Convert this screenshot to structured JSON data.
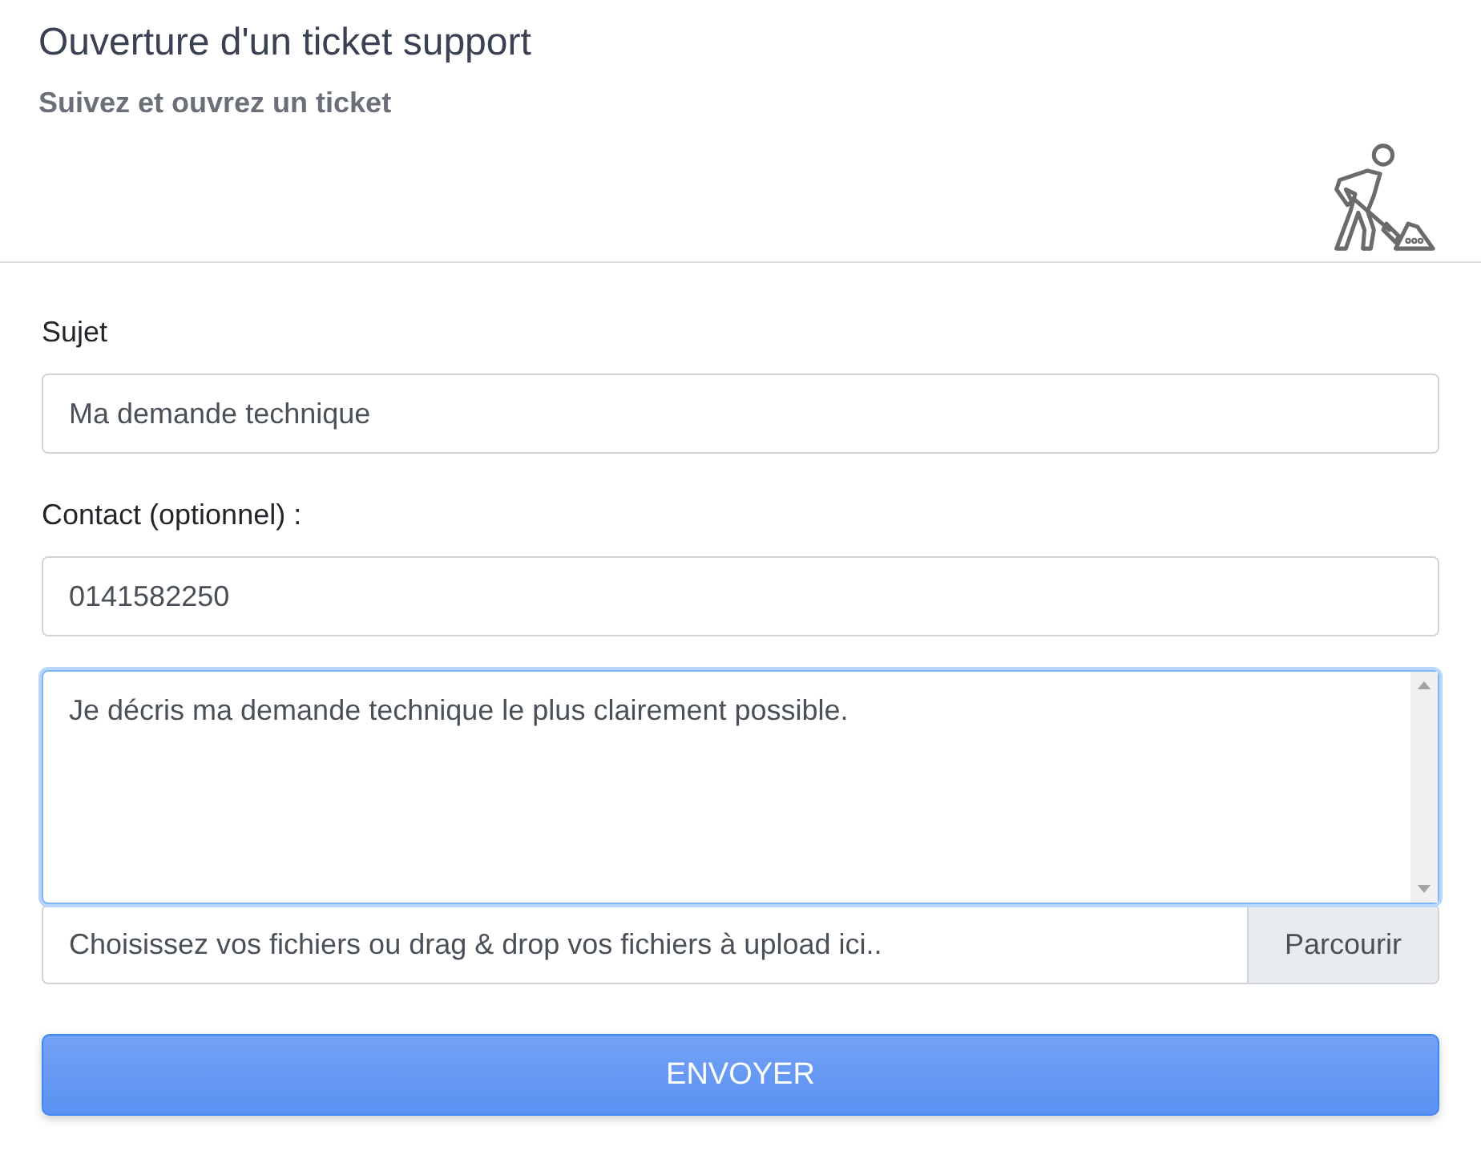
{
  "header": {
    "title": "Ouverture d'un ticket support",
    "subtitle": "Suivez et ouvrez un ticket"
  },
  "form": {
    "fields": [
      {
        "kind": "input",
        "label": "Sujet",
        "value": "Ma demande technique",
        "focused": false
      },
      {
        "kind": "input",
        "label": "Contact (optionnel) :",
        "value": "0141582250",
        "focused": false
      },
      {
        "kind": "textarea",
        "value": "Je décris ma demande technique le plus clairement possible.",
        "focused": true
      },
      {
        "kind": "file",
        "text": "Choisissez vos fichiers ou drag & drop vos fichiers à upload ici..",
        "button": "Parcourir",
        "focused": false
      }
    ],
    "submit": "ENVOYER"
  }
}
